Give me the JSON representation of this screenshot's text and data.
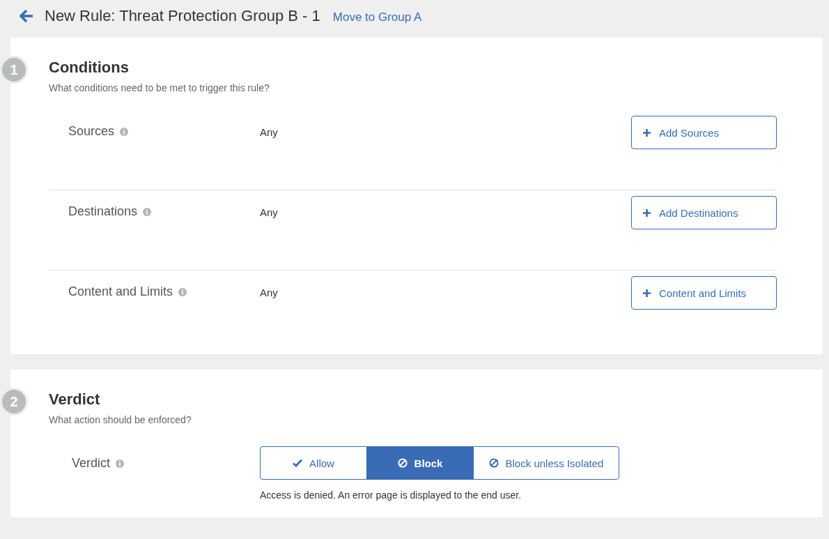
{
  "header": {
    "title": "New Rule: Threat Protection Group B - 1",
    "link": "Move to Group A"
  },
  "conditions": {
    "step": "1",
    "title": "Conditions",
    "subtitle": "What conditions need to be met to trigger this rule?",
    "rows": [
      {
        "label": "Sources",
        "value": "Any",
        "button": "Add Sources"
      },
      {
        "label": "Destinations",
        "value": "Any",
        "button": "Add Destinations"
      },
      {
        "label": "Content and Limits",
        "value": "Any",
        "button": "Content and Limits"
      }
    ]
  },
  "verdict": {
    "step": "2",
    "title": "Verdict",
    "subtitle": "What action should be enforced?",
    "label": "Verdict",
    "options": [
      {
        "label": "Allow",
        "kind": "check",
        "selected": false
      },
      {
        "label": "Block",
        "kind": "ban",
        "selected": true
      },
      {
        "label": "Block unless Isolated",
        "kind": "ban",
        "selected": false
      }
    ],
    "description": "Access is denied. An error page is displayed to the end user."
  }
}
